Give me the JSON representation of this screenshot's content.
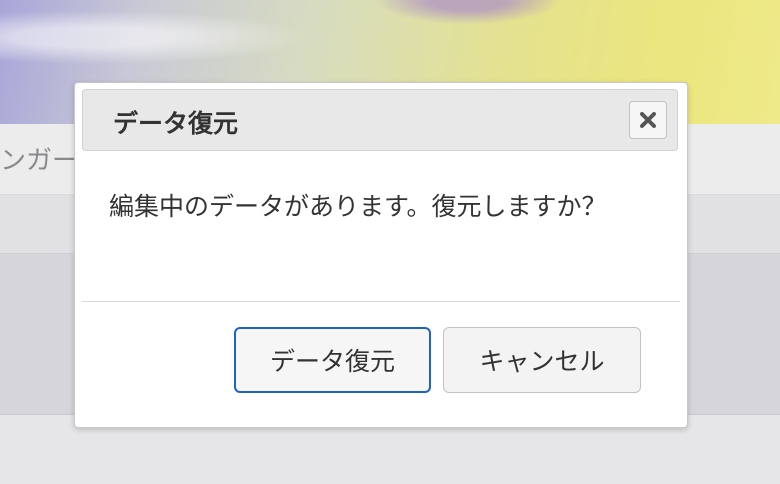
{
  "background": {
    "nav_text": "ンガー"
  },
  "dialog": {
    "title": "データ復元",
    "close_icon": "close-icon",
    "message": "編集中のデータがあります。復元しますか？",
    "buttons": {
      "restore_label": "データ復元",
      "cancel_label": "キャンセル"
    }
  },
  "colors": {
    "primary_focus_border": "#1e63c8",
    "titlebar_bg": "#e8e8e8",
    "text": "#333333"
  }
}
